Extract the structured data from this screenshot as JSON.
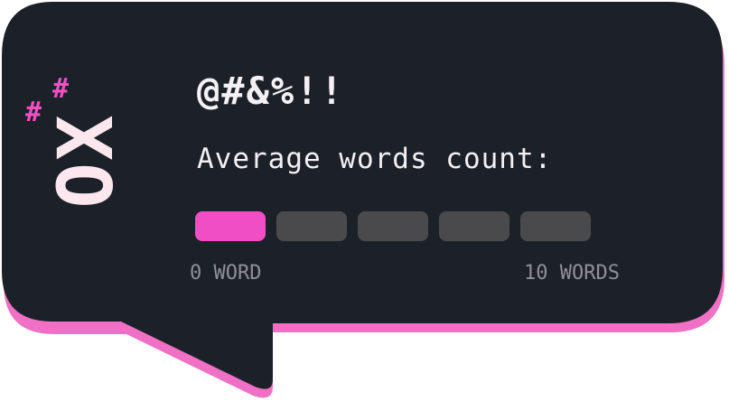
{
  "colors": {
    "bubble_bg": "#1c2129",
    "bubble_shadow": "#ef70c4",
    "accent": "#f04fc3",
    "segment_inactive": "#4a4a4c",
    "text_primary": "#f4f0f3",
    "text_muted": "#8e9095"
  },
  "logo": {
    "text": "OX",
    "hash_1": "#",
    "hash_2": "#"
  },
  "title": "@#&%!!",
  "subtitle": "Average words count:",
  "meter": {
    "total_segments": 5,
    "active_segments": 1,
    "min_label": "0 WORD",
    "max_label": "10 WORDS"
  }
}
